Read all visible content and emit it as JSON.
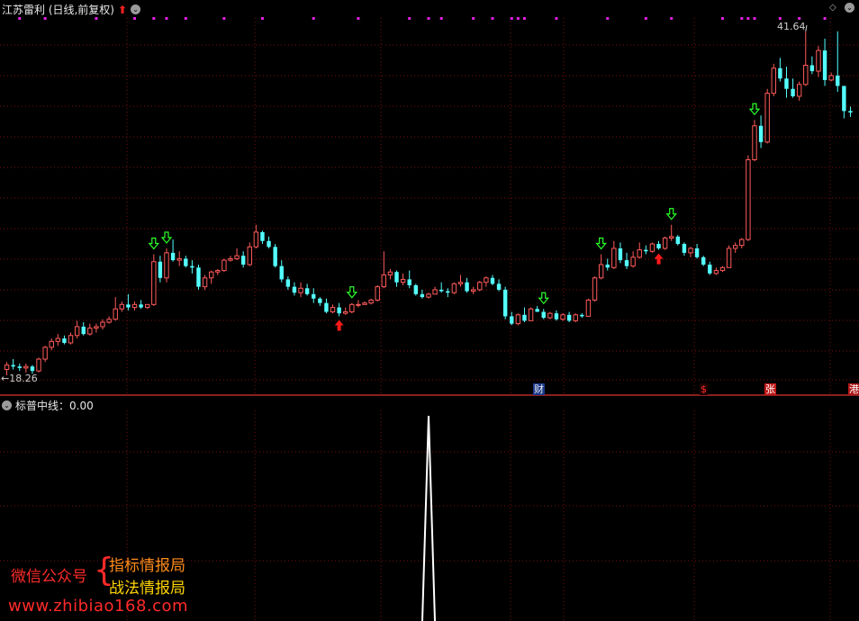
{
  "header": {
    "title": "江苏雷利 (日线,前复权)"
  },
  "sub_header": {
    "title": "标普中线：0.00"
  },
  "price_labels": {
    "high": "41.64",
    "low": "18.26"
  },
  "events": {
    "cai": "财",
    "s": "$",
    "zhang": "张",
    "gang": "港"
  },
  "watermark": {
    "left": "微信公众号",
    "brace": "{",
    "right1": "指标情报局",
    "right2": "战法情报局",
    "url": "www.zhibiao168.com"
  },
  "colors": {
    "up": "#ff5a5a",
    "down": "#54ffff",
    "grid": "#7a1010",
    "marker": "#e020e0",
    "buy_arrow": "#ff1a1a",
    "sell_arrow": "#2aff2a",
    "indicator": "#ffffff"
  },
  "chart_data": {
    "type": "candlestick",
    "y_range": [
      18.0,
      42.5
    ],
    "candles": [
      [
        18.7,
        19.2,
        18.3,
        19.0
      ],
      [
        19.0,
        19.4,
        18.7,
        18.9
      ],
      [
        18.9,
        19.1,
        18.6,
        18.8
      ],
      [
        18.8,
        19.1,
        18.5,
        18.9
      ],
      [
        18.9,
        19.0,
        18.4,
        18.6
      ],
      [
        18.6,
        19.5,
        18.5,
        19.4
      ],
      [
        19.4,
        20.3,
        19.2,
        20.2
      ],
      [
        20.2,
        20.8,
        20.0,
        20.6
      ],
      [
        20.6,
        21.1,
        20.3,
        20.8
      ],
      [
        20.8,
        21.0,
        20.4,
        20.5
      ],
      [
        20.5,
        21.2,
        20.4,
        21.0
      ],
      [
        21.0,
        22.0,
        20.8,
        21.6
      ],
      [
        21.6,
        21.9,
        21.0,
        21.1
      ],
      [
        21.1,
        21.8,
        21.0,
        21.5
      ],
      [
        21.5,
        21.8,
        21.2,
        21.6
      ],
      [
        21.6,
        22.1,
        21.4,
        21.9
      ],
      [
        21.9,
        22.3,
        21.8,
        22.1
      ],
      [
        22.1,
        23.6,
        22.0,
        22.8
      ],
      [
        22.8,
        23.3,
        22.6,
        23.1
      ],
      [
        23.1,
        23.8,
        22.7,
        22.9
      ],
      [
        22.9,
        23.3,
        22.7,
        23.1
      ],
      [
        23.1,
        23.4,
        22.8,
        22.9
      ],
      [
        22.9,
        23.1,
        22.8,
        23.1
      ],
      [
        23.1,
        26.5,
        23.0,
        26.0
      ],
      [
        26.0,
        26.4,
        24.6,
        24.9
      ],
      [
        24.9,
        26.9,
        24.6,
        26.6
      ],
      [
        26.6,
        27.5,
        26.0,
        26.1
      ],
      [
        26.1,
        26.7,
        25.7,
        26.2
      ],
      [
        26.2,
        26.4,
        25.6,
        25.7
      ],
      [
        25.7,
        26.1,
        25.2,
        25.6
      ],
      [
        25.6,
        25.8,
        24.1,
        24.3
      ],
      [
        24.3,
        25.1,
        24.1,
        24.9
      ],
      [
        24.9,
        25.4,
        24.5,
        25.3
      ],
      [
        25.3,
        25.5,
        25.1,
        25.4
      ],
      [
        25.4,
        26.2,
        25.3,
        26.1
      ],
      [
        26.1,
        26.4,
        26.0,
        26.2
      ],
      [
        26.2,
        26.9,
        26.1,
        26.4
      ],
      [
        26.4,
        26.7,
        25.6,
        25.8
      ],
      [
        25.8,
        27.3,
        25.7,
        27.0
      ],
      [
        27.0,
        28.5,
        26.9,
        28.0
      ],
      [
        28.0,
        28.1,
        27.2,
        27.4
      ],
      [
        27.4,
        27.7,
        26.9,
        27.0
      ],
      [
        27.0,
        27.2,
        25.6,
        25.7
      ],
      [
        25.7,
        26.1,
        24.6,
        24.8
      ],
      [
        24.8,
        25.0,
        24.1,
        24.3
      ],
      [
        24.3,
        24.6,
        23.7,
        23.9
      ],
      [
        23.9,
        24.6,
        23.6,
        24.2
      ],
      [
        24.2,
        24.5,
        23.7,
        23.8
      ],
      [
        23.8,
        24.2,
        23.2,
        23.5
      ],
      [
        23.5,
        23.6,
        23.0,
        23.2
      ],
      [
        23.2,
        23.5,
        22.5,
        22.6
      ],
      [
        22.6,
        23.1,
        22.5,
        22.9
      ],
      [
        22.9,
        23.2,
        22.3,
        22.5
      ],
      [
        22.5,
        22.9,
        22.4,
        22.6
      ],
      [
        22.6,
        23.2,
        22.5,
        23.1
      ],
      [
        23.1,
        23.4,
        22.9,
        23.1
      ],
      [
        23.1,
        23.3,
        23.1,
        23.2
      ],
      [
        23.2,
        23.5,
        23.1,
        23.4
      ],
      [
        23.4,
        24.4,
        23.3,
        24.3
      ],
      [
        24.3,
        26.7,
        24.2,
        25.1
      ],
      [
        25.1,
        25.5,
        24.8,
        25.3
      ],
      [
        25.3,
        25.4,
        24.3,
        24.6
      ],
      [
        24.6,
        25.2,
        24.4,
        24.8
      ],
      [
        24.8,
        25.4,
        24.2,
        24.4
      ],
      [
        24.4,
        24.5,
        23.7,
        23.8
      ],
      [
        23.8,
        24.1,
        23.5,
        23.6
      ],
      [
        23.6,
        23.9,
        23.5,
        23.8
      ],
      [
        23.8,
        24.3,
        23.8,
        24.1
      ],
      [
        24.1,
        24.6,
        23.9,
        24.0
      ],
      [
        24.0,
        24.2,
        23.6,
        23.9
      ],
      [
        23.9,
        24.6,
        23.8,
        24.5
      ],
      [
        24.5,
        25.1,
        24.3,
        24.6
      ],
      [
        24.6,
        24.9,
        23.9,
        24.0
      ],
      [
        24.0,
        24.3,
        23.8,
        24.1
      ],
      [
        24.1,
        24.7,
        24.0,
        24.6
      ],
      [
        24.6,
        25.0,
        24.3,
        24.9
      ],
      [
        24.9,
        25.1,
        24.4,
        24.5
      ],
      [
        24.5,
        24.8,
        24.0,
        24.1
      ],
      [
        24.1,
        24.3,
        22.1,
        22.3
      ],
      [
        22.3,
        22.6,
        21.7,
        21.8
      ],
      [
        21.8,
        22.5,
        21.7,
        22.4
      ],
      [
        22.4,
        22.9,
        21.9,
        22.0
      ],
      [
        22.0,
        22.9,
        22.0,
        22.8
      ],
      [
        22.8,
        23.0,
        22.6,
        22.6
      ],
      [
        22.6,
        22.8,
        22.1,
        22.2
      ],
      [
        22.2,
        22.6,
        22.1,
        22.5
      ],
      [
        22.5,
        22.7,
        22.0,
        22.1
      ],
      [
        22.1,
        22.5,
        22.0,
        22.4
      ],
      [
        22.4,
        22.6,
        21.9,
        22.0
      ],
      [
        22.0,
        22.5,
        21.9,
        22.4
      ],
      [
        22.4,
        22.5,
        22.2,
        22.3
      ],
      [
        22.3,
        23.5,
        22.3,
        23.4
      ],
      [
        23.4,
        25.0,
        23.3,
        24.9
      ],
      [
        24.9,
        26.5,
        24.8,
        25.8
      ],
      [
        25.8,
        26.2,
        25.4,
        25.6
      ],
      [
        25.6,
        27.4,
        25.5,
        26.9
      ],
      [
        26.9,
        27.3,
        25.9,
        26.1
      ],
      [
        26.1,
        26.6,
        25.5,
        25.7
      ],
      [
        25.7,
        26.7,
        25.6,
        26.3
      ],
      [
        26.3,
        27.3,
        26.2,
        26.8
      ],
      [
        26.8,
        27.1,
        26.5,
        26.7
      ],
      [
        26.7,
        27.3,
        26.6,
        27.2
      ],
      [
        27.2,
        27.4,
        26.8,
        26.9
      ],
      [
        26.9,
        27.7,
        26.8,
        27.6
      ],
      [
        27.6,
        28.5,
        27.4,
        27.7
      ],
      [
        27.7,
        27.8,
        27.1,
        27.2
      ],
      [
        27.2,
        27.3,
        26.4,
        26.6
      ],
      [
        26.6,
        27.0,
        26.3,
        26.9
      ],
      [
        26.9,
        27.2,
        26.2,
        26.3
      ],
      [
        26.3,
        26.4,
        25.7,
        25.8
      ],
      [
        25.8,
        26.0,
        25.1,
        25.2
      ],
      [
        25.2,
        25.6,
        25.1,
        25.4
      ],
      [
        25.4,
        25.7,
        25.3,
        25.6
      ],
      [
        25.6,
        27.1,
        25.6,
        26.9
      ],
      [
        26.9,
        27.3,
        26.6,
        27.1
      ],
      [
        27.1,
        27.6,
        26.9,
        27.5
      ],
      [
        27.5,
        33.2,
        27.4,
        32.9
      ],
      [
        32.9,
        35.6,
        32.8,
        35.2
      ],
      [
        35.2,
        35.9,
        33.7,
        34.1
      ],
      [
        34.1,
        37.7,
        34.0,
        37.4
      ],
      [
        37.4,
        39.4,
        37.2,
        39.1
      ],
      [
        39.1,
        39.8,
        38.2,
        38.4
      ],
      [
        38.4,
        39.2,
        37.1,
        37.7
      ],
      [
        37.7,
        38.4,
        37.1,
        37.2
      ],
      [
        37.2,
        38.2,
        36.9,
        38.0
      ],
      [
        38.0,
        41.6,
        37.9,
        39.3
      ],
      [
        39.3,
        39.9,
        38.7,
        38.9
      ],
      [
        38.9,
        40.6,
        38.5,
        40.3
      ],
      [
        40.3,
        41.1,
        37.9,
        38.3
      ],
      [
        38.3,
        38.8,
        38.2,
        38.6
      ],
      [
        38.6,
        41.6,
        37.5,
        37.9
      ],
      [
        37.9,
        37.5,
        35.7,
        36.2
      ],
      [
        36.2,
        36.5,
        35.8,
        36.1
      ]
    ],
    "sell_signal_indices": [
      23,
      25,
      54,
      84,
      93,
      104,
      117
    ],
    "buy_signal_indices": [
      52,
      102
    ],
    "top_marker_indices": [
      2,
      6,
      14,
      20,
      23,
      25,
      28,
      34,
      40,
      48,
      55,
      63,
      66,
      68,
      73,
      76,
      79,
      80,
      81,
      86,
      94,
      100,
      104,
      112,
      115,
      116,
      117,
      121,
      124,
      128
    ],
    "indicator": {
      "name": "标普中线",
      "value": 0.0,
      "spike_index": 66
    }
  }
}
